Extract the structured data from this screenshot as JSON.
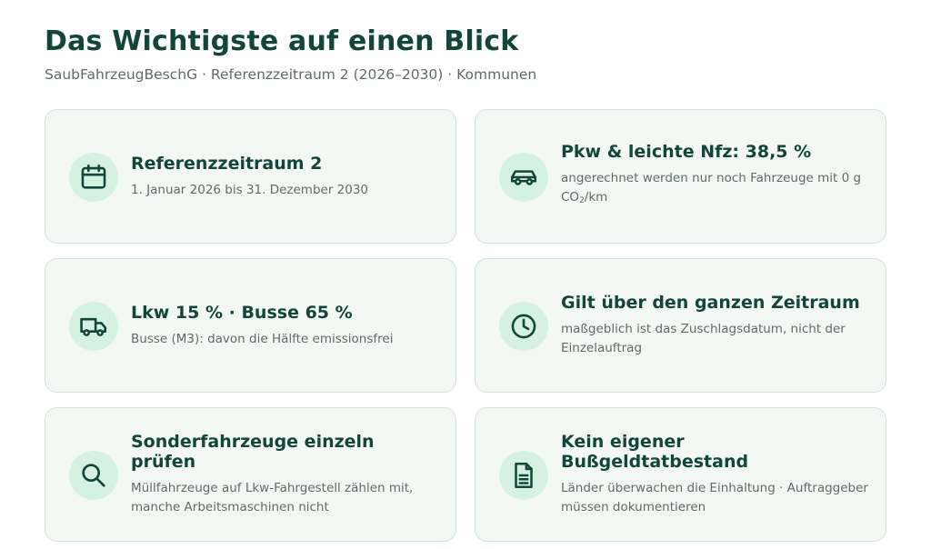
{
  "header": {
    "title": "Das Wichtigste auf einen Blick",
    "subtitle": "SaubFahrzeugBeschG · Referenzzeitraum 2 (2026–2030) · Kommunen"
  },
  "cards": [
    {
      "icon": "calendar-icon",
      "title": "Referenzzeitraum 2",
      "desc": "1. Januar 2026 bis 31. Dezember 2030"
    },
    {
      "icon": "car-icon",
      "title": "Pkw & leichte Nfz: 38,5 %",
      "desc_before": "angerechnet werden nur noch Fahrzeuge mit 0 g CO",
      "desc_sub": "2",
      "desc_after": "/km"
    },
    {
      "icon": "truck-icon",
      "title": "Lkw 15 % · Busse 65 %",
      "desc": "Busse (M3): davon die Hälfte emissionsfrei"
    },
    {
      "icon": "clock-icon",
      "title": "Gilt über den ganzen Zeitraum",
      "desc": "maßgeblich ist das Zuschlagsdatum, nicht der Einzelauftrag"
    },
    {
      "icon": "search-icon",
      "title": "Sonderfahrzeuge einzeln prüfen",
      "desc": "Müllfahrzeuge auf Lkw-Fahrgestell zählen mit, manche Arbeitsmaschinen nicht"
    },
    {
      "icon": "document-icon",
      "title": "Kein eigener Bußgeldtatbestand",
      "desc": "Länder überwachen die Einhaltung · Auftraggeber müssen dokumentieren"
    }
  ],
  "colors": {
    "accent": "#12463a",
    "icon_bg": "#d4f1e1",
    "card_bg": "#f3f8f5",
    "card_border": "#d3e2da",
    "muted_text": "#5e6c67"
  }
}
